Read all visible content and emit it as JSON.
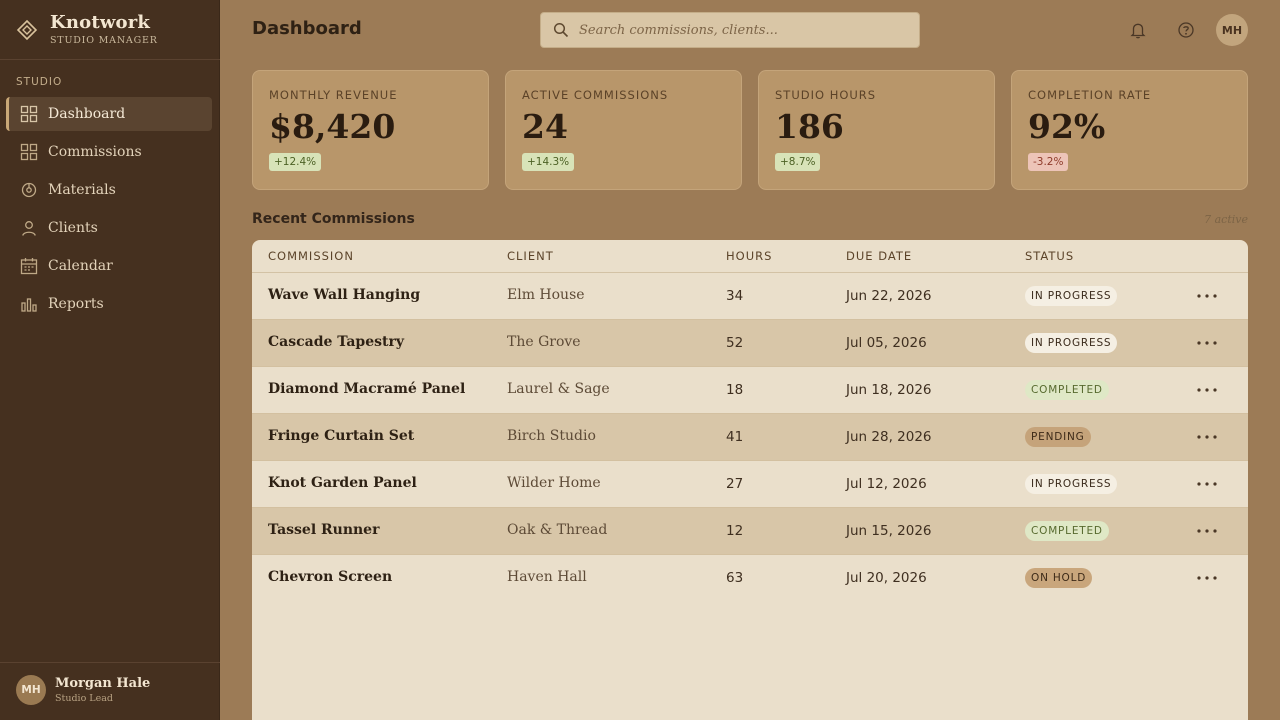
{
  "sidebar": {
    "brand": {
      "name": "Knotwork",
      "subtitle": "STUDIO MANAGER"
    },
    "section_label": "STUDIO",
    "items": [
      {
        "label": "Dashboard",
        "icon": "grid-icon",
        "active": true
      },
      {
        "label": "Commissions",
        "icon": "grid-icon",
        "active": false
      },
      {
        "label": "Materials",
        "icon": "spool-icon",
        "active": false
      },
      {
        "label": "Clients",
        "icon": "person-icon",
        "active": false
      },
      {
        "label": "Calendar",
        "icon": "calendar-icon",
        "active": false
      },
      {
        "label": "Reports",
        "icon": "bar-chart-icon",
        "active": false
      }
    ],
    "user": {
      "initials": "MH",
      "name": "Morgan Hale",
      "role": "Studio Lead"
    }
  },
  "header": {
    "title": "Dashboard",
    "search_placeholder": "Search commissions, clients...",
    "user_initials": "MH"
  },
  "stats": [
    {
      "label": "MONTHLY REVENUE",
      "value": "$8,420",
      "delta": "+12.4%",
      "trend": "up"
    },
    {
      "label": "ACTIVE COMMISSIONS",
      "value": "24",
      "delta": "+14.3%",
      "trend": "up"
    },
    {
      "label": "STUDIO HOURS",
      "value": "186",
      "delta": "+8.7%",
      "trend": "up"
    },
    {
      "label": "COMPLETION RATE",
      "value": "92%",
      "delta": "-3.2%",
      "trend": "down"
    }
  ],
  "commissions": {
    "title": "Recent Commissions",
    "count_label": "7 active",
    "columns": [
      "COMMISSION",
      "CLIENT",
      "HOURS",
      "DUE DATE",
      "STATUS"
    ],
    "rows": [
      {
        "name": "Wave Wall Hanging",
        "client": "Elm House",
        "hours": "34",
        "due": "Jun 22, 2026",
        "status": "IN PROGRESS"
      },
      {
        "name": "Cascade Tapestry",
        "client": "The Grove",
        "hours": "52",
        "due": "Jul 05, 2026",
        "status": "IN PROGRESS"
      },
      {
        "name": "Diamond Macramé Panel",
        "client": "Laurel & Sage",
        "hours": "18",
        "due": "Jun 18, 2026",
        "status": "COMPLETED"
      },
      {
        "name": "Fringe Curtain Set",
        "client": "Birch Studio",
        "hours": "41",
        "due": "Jun 28, 2026",
        "status": "PENDING"
      },
      {
        "name": "Knot Garden Panel",
        "client": "Wilder Home",
        "hours": "27",
        "due": "Jul 12, 2026",
        "status": "IN PROGRESS"
      },
      {
        "name": "Tassel Runner",
        "client": "Oak & Thread",
        "hours": "12",
        "due": "Jun 15, 2026",
        "status": "COMPLETED"
      },
      {
        "name": "Chevron Screen",
        "client": "Haven Hall",
        "hours": "63",
        "due": "Jul 20, 2026",
        "status": "ON HOLD"
      }
    ]
  },
  "colors": {
    "sidebar_bg": "#45301f",
    "page_bg": "#9c7b56",
    "card_bg": "#b8966a",
    "table_bg": "#eadfcb",
    "accent": "#c9a877",
    "positive": "#4c6124",
    "negative": "#8e3a2a"
  }
}
